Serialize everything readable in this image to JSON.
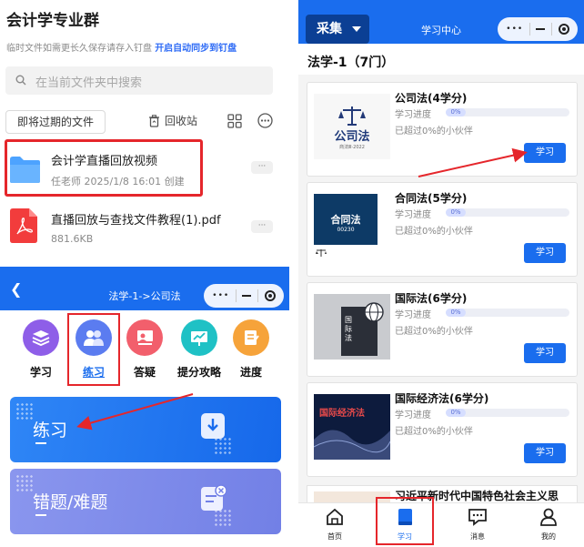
{
  "files_panel": {
    "title": "会计学专业群",
    "subtitle": "临时文件如需更长久保存请存入钉盘",
    "subtitle_link": "开启自动同步到钉盘",
    "search_placeholder": "在当前文件夹中搜索",
    "expiring_chip": "即将过期的文件",
    "recycle_label": "回收站",
    "files": [
      {
        "name": "会计学直播回放视频",
        "meta": "任老师 2025/1/8 16:01 创建",
        "type": "folder",
        "more": "···"
      },
      {
        "name": "直播回放与查找文件教程(1).pdf",
        "meta": "881.6KB",
        "type": "pdf",
        "more": "···"
      }
    ]
  },
  "practice_panel": {
    "nav_title": "法学-1->公司法",
    "capsule_dots": "•••",
    "categories": [
      {
        "label": "学习",
        "color": "#8e5ee8",
        "icon": "stack-icon"
      },
      {
        "label": "练习",
        "color": "#5b7cf0",
        "icon": "people-icon"
      },
      {
        "label": "答疑",
        "color": "#f25f6c",
        "icon": "teacher-icon"
      },
      {
        "label": "提分攻略",
        "color": "#1fc1c5",
        "icon": "chart-board-icon"
      },
      {
        "label": "进度",
        "color": "#f6a33a",
        "icon": "notepad-icon"
      }
    ],
    "cards": [
      {
        "label": "练习",
        "color": "#1f78f0",
        "icon": "download-tray-icon"
      },
      {
        "label": "错题/难题",
        "color": "#7d8be8",
        "icon": "error-note-icon"
      }
    ]
  },
  "courses_panel": {
    "collect_button": "采集",
    "nav_title": "学习中心",
    "section_title": "法学-1（7门）",
    "progress_label": "学习进度",
    "study_button": "学习",
    "courses": [
      {
        "name": "公司法(4学分)",
        "progress": 0,
        "progress_text": "0%",
        "beat_text": "已超过0%的小伙伴",
        "thumb_title": "公司法",
        "thumb_sub": "商法Ⅲ·2022"
      },
      {
        "name": "合同法(5学分)",
        "progress": 0,
        "progress_text": "0%",
        "beat_text": "已超过0%的小伙伴",
        "thumb_title": "合同法",
        "thumb_sub": "00230"
      },
      {
        "name": "国际法(6学分)",
        "progress": 0,
        "progress_text": "0%",
        "beat_text": "已超过0%的小伙伴",
        "thumb_title": "国际法",
        "thumb_sub": ""
      },
      {
        "name": "国际经济法(6学分)",
        "progress": 0,
        "progress_text": "0%",
        "beat_text": "已超过0%的小伙伴",
        "thumb_title": "国际经济法",
        "thumb_sub": ""
      }
    ],
    "partial_course_name": "习近平新时代中国特色社会主义思",
    "tabs": [
      {
        "label": "首页",
        "icon": "home-icon"
      },
      {
        "label": "学习",
        "icon": "book-icon"
      },
      {
        "label": "消息",
        "icon": "message-icon"
      },
      {
        "label": "我的",
        "icon": "user-icon"
      }
    ]
  },
  "colors": {
    "primary": "#1a6dee",
    "highlight": "#e5262b"
  }
}
